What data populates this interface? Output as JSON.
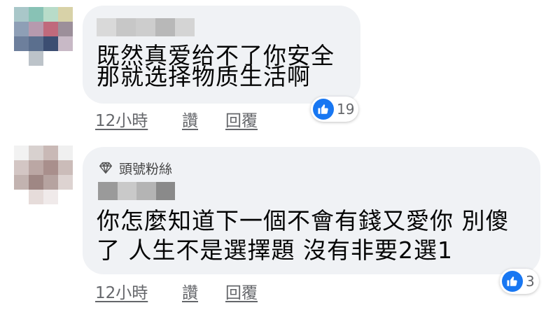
{
  "comments": [
    {
      "text_lines": [
        "既然真爱给不了你安全",
        "那就选择物质生活啊"
      ],
      "time": "12小時",
      "like_label": "讚",
      "reply_label": "回覆",
      "reaction_count": "19"
    },
    {
      "badge": "頭號粉絲",
      "text_lines": [
        "你怎麼知道下一個不會有錢又愛你 別傻",
        "了 人生不是選擇題 沒有非要2選1"
      ],
      "time": "12小時",
      "like_label": "讚",
      "reply_label": "回覆",
      "reaction_count": "3"
    }
  ],
  "icons": {
    "reaction": "like-thumbs-up-icon",
    "badge": "diamond-icon"
  },
  "colors": {
    "bubble": "#f0f2f5",
    "like_blue": "#1877f2",
    "meta_text": "#65676b"
  }
}
